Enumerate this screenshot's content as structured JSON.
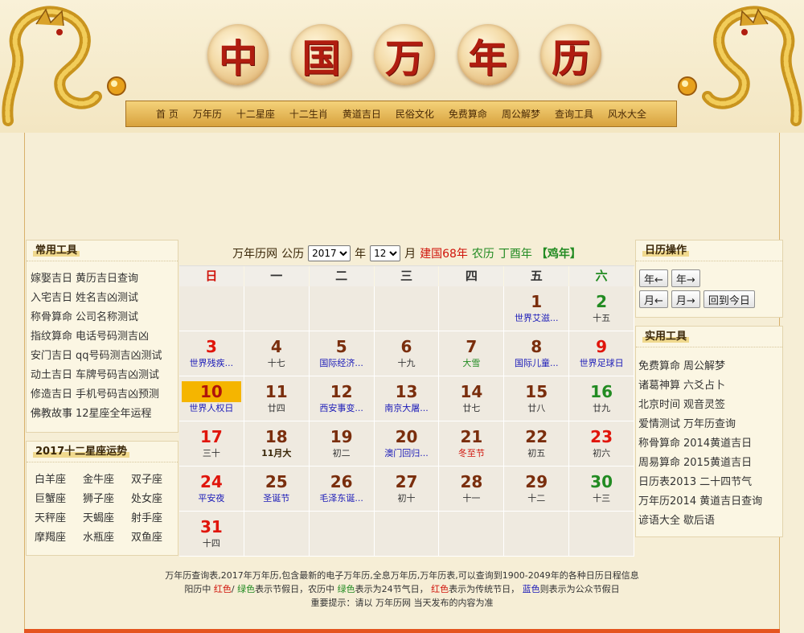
{
  "header": {
    "title_chars": [
      "中",
      "国",
      "万",
      "年",
      "历"
    ],
    "nav": [
      "首 页",
      "万年历",
      "十二星座",
      "十二生肖",
      "黄道吉日",
      "民俗文化",
      "免费算命",
      "周公解梦",
      "查询工具",
      "风水大全"
    ]
  },
  "tools": {
    "title": "常用工具",
    "rows": [
      [
        "嫁娶吉日",
        "黄历吉日查询"
      ],
      [
        "入宅吉日",
        "姓名吉凶测试"
      ],
      [
        "称骨算命",
        "公司名称测试"
      ],
      [
        "指纹算命",
        "电话号码测吉凶"
      ],
      [
        "安门吉日",
        "qq号码测吉凶测试"
      ],
      [
        "动土吉日",
        "车牌号码吉凶测试"
      ],
      [
        "修造吉日",
        "手机号码吉凶预测"
      ],
      [
        "佛教故事",
        "12星座全年运程"
      ]
    ]
  },
  "horoscope": {
    "title": "2017十二星座运势",
    "signs": [
      "白羊座",
      "金牛座",
      "双子座",
      "巨蟹座",
      "狮子座",
      "处女座",
      "天秤座",
      "天蝎座",
      "射手座",
      "摩羯座",
      "水瓶座",
      "双鱼座"
    ]
  },
  "calendar_header": {
    "site": "万年历网",
    "gregorian_label": "公历",
    "year": "2017",
    "year_unit": "年",
    "month": "12",
    "month_unit": "月",
    "roc": "建国68年",
    "lunar_label": "农历",
    "ganzhi": "丁酉年",
    "zodiac": "【鸡年】"
  },
  "weekdays": [
    "日",
    "一",
    "二",
    "三",
    "四",
    "五",
    "六"
  ],
  "weeks": [
    [
      null,
      null,
      null,
      null,
      null,
      {
        "d": "1",
        "s": "世界艾滋...",
        "sc": "blue"
      },
      {
        "d": "2",
        "s": "十五",
        "dc": "green"
      }
    ],
    [
      {
        "d": "3",
        "s": "世界残疾...",
        "sc": "blue",
        "dc": "red"
      },
      {
        "d": "4",
        "s": "十七"
      },
      {
        "d": "5",
        "s": "国际经济...",
        "sc": "blue"
      },
      {
        "d": "6",
        "s": "十九"
      },
      {
        "d": "7",
        "s": "大雪",
        "sc": "green"
      },
      {
        "d": "8",
        "s": "国际儿童...",
        "sc": "blue"
      },
      {
        "d": "9",
        "s": "世界足球日",
        "sc": "blue",
        "dc": "red"
      }
    ],
    [
      {
        "d": "10",
        "s": "世界人权日",
        "sc": "blue",
        "dc": "red",
        "today": true
      },
      {
        "d": "11",
        "s": "廿四"
      },
      {
        "d": "12",
        "s": "西安事变...",
        "sc": "blue"
      },
      {
        "d": "13",
        "s": "南京大屠...",
        "sc": "blue"
      },
      {
        "d": "14",
        "s": "廿七"
      },
      {
        "d": "15",
        "s": "廿八"
      },
      {
        "d": "16",
        "s": "廿九",
        "dc": "green"
      }
    ],
    [
      {
        "d": "17",
        "s": "三十",
        "dc": "red"
      },
      {
        "d": "18",
        "s": "11月大",
        "sc": "bold"
      },
      {
        "d": "19",
        "s": "初二"
      },
      {
        "d": "20",
        "s": "澳门回归...",
        "sc": "blue"
      },
      {
        "d": "21",
        "s": "冬至节",
        "sc": "red"
      },
      {
        "d": "22",
        "s": "初五"
      },
      {
        "d": "23",
        "s": "初六",
        "dc": "red"
      }
    ],
    [
      {
        "d": "24",
        "s": "平安夜",
        "sc": "blue",
        "dc": "red"
      },
      {
        "d": "25",
        "s": "圣诞节",
        "sc": "blue"
      },
      {
        "d": "26",
        "s": "毛泽东诞...",
        "sc": "blue"
      },
      {
        "d": "27",
        "s": "初十"
      },
      {
        "d": "28",
        "s": "十一"
      },
      {
        "d": "29",
        "s": "十二"
      },
      {
        "d": "30",
        "s": "十三",
        "dc": "green"
      }
    ],
    [
      {
        "d": "31",
        "s": "十四",
        "dc": "red"
      },
      null,
      null,
      null,
      null,
      null,
      null
    ]
  ],
  "ops": {
    "title": "日历操作",
    "row1": [
      "年←",
      "年→"
    ],
    "row2": [
      "月←",
      "月→",
      "回到今日"
    ]
  },
  "util": {
    "title": "实用工具",
    "rows": [
      [
        "免费算命",
        "周公解梦"
      ],
      [
        "诸葛神算",
        "六爻占卜"
      ],
      [
        "北京时间",
        "观音灵签"
      ],
      [
        "爱情测试",
        "万年历查询"
      ],
      [
        "称骨算命",
        "2014黄道吉日"
      ],
      [
        "周易算命",
        "2015黄道吉日"
      ],
      [
        "日历表2013",
        "二十四节气"
      ],
      [
        "万年历2014",
        "黄道吉日查询"
      ],
      [
        "谚语大全",
        "歇后语"
      ]
    ]
  },
  "footer": {
    "line1": "万年历查询表,2017年万年历,包含最新的电子万年历,全息万年历,万年历表,可以查询到1900-2049年的各种日历日程信息",
    "line2_a": "阳历中 ",
    "line2_red": "红色",
    "line2_b": "/ ",
    "line2_green": "绿色",
    "line2_c": "表示节假日，农历中 ",
    "line2_green2": "绿色",
    "line2_d": "表示为24节气日， ",
    "line2_red2": "红色",
    "line2_e": "表示为传统节日， ",
    "line2_blue": "蓝色",
    "line2_f": "则表示为公众节假日",
    "line3": "重要提示：请以 万年历网 当天发布的内容为准"
  },
  "colors": {
    "red": "#d0140b",
    "green": "#228b22",
    "blue": "#1a1ab8",
    "today_bg": "#f5b500",
    "nav_bg": "#e0b04f"
  }
}
